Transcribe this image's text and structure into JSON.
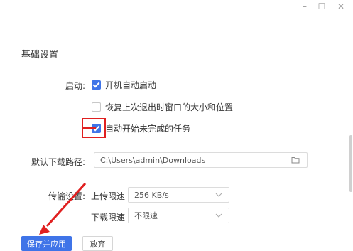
{
  "window_controls": {
    "minimize": "–",
    "maximize": "☐",
    "close": "✕"
  },
  "section": {
    "title": "基础设置"
  },
  "startup": {
    "label": "启动:",
    "options": [
      {
        "text": "开机自动启动",
        "checked": true
      },
      {
        "text": "恢复上次退出时窗口的大小和位置",
        "checked": false
      },
      {
        "text": "自动开始未完成的任务",
        "checked": true
      }
    ]
  },
  "download_path": {
    "label": "默认下载路径:",
    "value": "C:\\Users\\admin\\Downloads",
    "browse_icon": "folder-icon"
  },
  "transfer": {
    "label": "传输设置:",
    "upload": {
      "label": "上传限速",
      "value": "256 KB/s"
    },
    "download": {
      "label": "下载限速",
      "value": "不限速"
    }
  },
  "actions": {
    "save": "保存并应用",
    "discard": "放弃"
  },
  "colors": {
    "accent": "#3f74e8",
    "annotation": "#e02020"
  }
}
